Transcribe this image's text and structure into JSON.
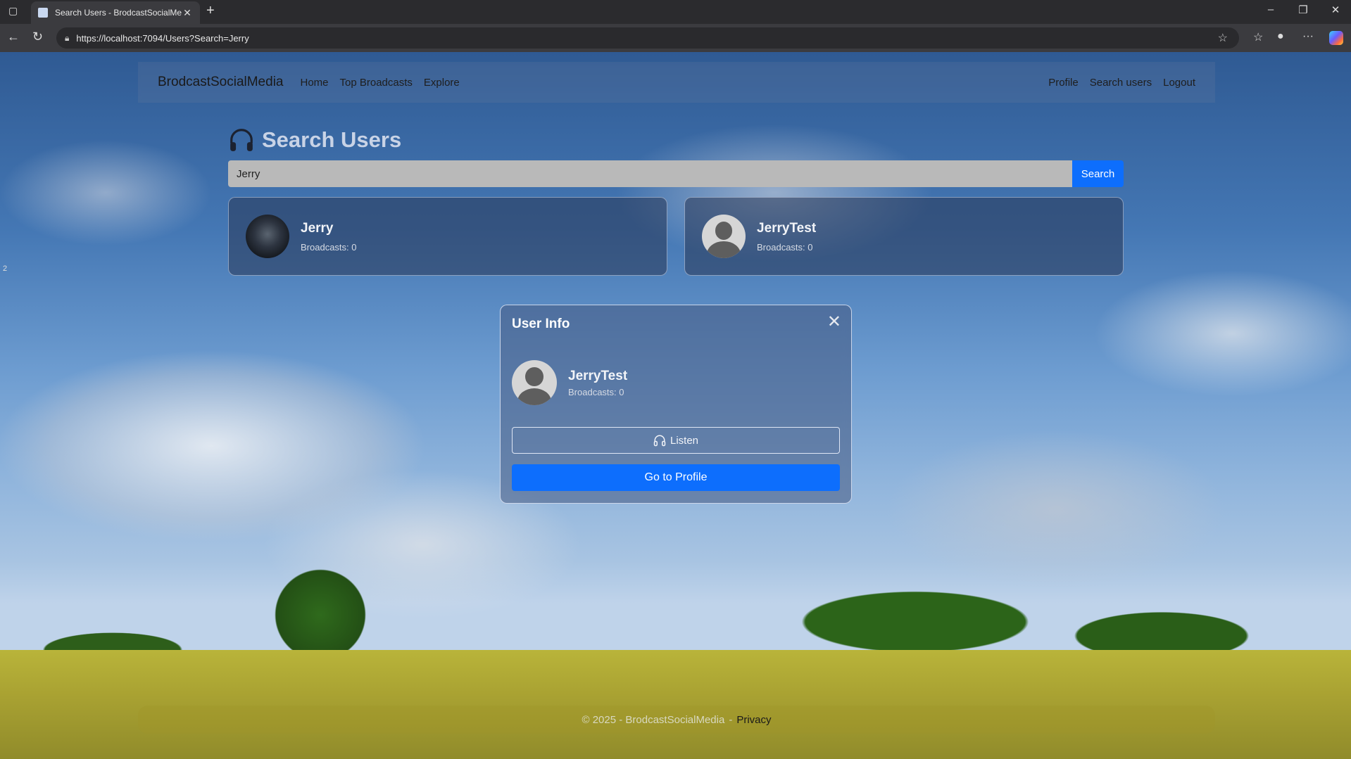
{
  "browser": {
    "tab_title": "Search Users - BrodcastSocialMe",
    "url": "https://localhost:7094/Users?Search=Jerry"
  },
  "navbar": {
    "brand": "BrodcastSocialMedia",
    "links": [
      "Home",
      "Top Broadcasts",
      "Explore"
    ],
    "right_links": [
      "Profile",
      "Search users",
      "Logout"
    ]
  },
  "page": {
    "title": "Search Users",
    "search_value": "Jerry",
    "search_button": "Search"
  },
  "results": [
    {
      "name": "Jerry",
      "broadcasts": "Broadcasts: 0"
    },
    {
      "name": "JerryTest",
      "broadcasts": "Broadcasts: 0"
    }
  ],
  "modal": {
    "title": "User Info",
    "user_name": "JerryTest",
    "broadcasts": "Broadcasts: 0",
    "listen_label": "Listen",
    "profile_label": "Go to Profile"
  },
  "footer": {
    "copyright": "© 2025 - BrodcastSocialMedia",
    "separator": "-",
    "privacy": "Privacy"
  },
  "side_marker": "2",
  "colors": {
    "accent": "#0d6efd"
  }
}
